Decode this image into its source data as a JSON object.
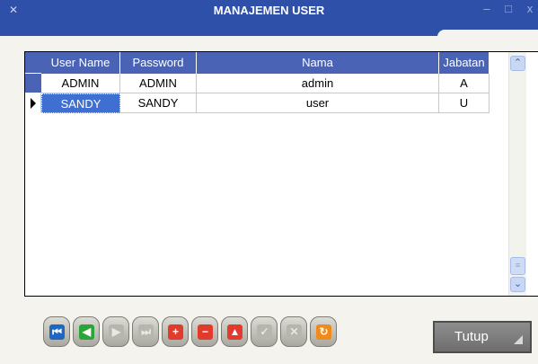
{
  "window": {
    "title": "MANAJEMEN USER",
    "icon": "restore-icon",
    "controls": {
      "minimize": "–",
      "maximize": "□",
      "close": "x"
    }
  },
  "grid": {
    "columns": [
      "User Name",
      "Password",
      "Nama",
      "Jabatan"
    ],
    "rows": [
      {
        "username": "ADMIN",
        "password": "ADMIN",
        "nama": "admin",
        "jabatan": "A"
      },
      {
        "username": "SANDY",
        "password": "SANDY",
        "nama": "user",
        "jabatan": "U"
      }
    ],
    "current_row": 1,
    "selected_column": "User Name"
  },
  "scrollbar": {
    "up_icon": "chevron-up-icon",
    "down_icon": "chevron-down-icon",
    "up_glyph": "⌃",
    "down_glyph": "⌄",
    "thumb_glyph": "≡"
  },
  "navigator": [
    {
      "name": "first-record-button",
      "icon": "first-record-icon",
      "glyph": "⏮",
      "color": "blue",
      "enabled": true
    },
    {
      "name": "previous-record-button",
      "icon": "previous-record-icon",
      "glyph": "◀",
      "color": "green",
      "enabled": true
    },
    {
      "name": "next-record-button",
      "icon": "next-record-icon",
      "glyph": "▶",
      "color": "gray",
      "enabled": false
    },
    {
      "name": "last-record-button",
      "icon": "last-record-icon",
      "glyph": "⏭",
      "color": "gray",
      "enabled": false
    },
    {
      "name": "insert-record-button",
      "icon": "plus-icon",
      "glyph": "+",
      "color": "red",
      "enabled": true
    },
    {
      "name": "delete-record-button",
      "icon": "minus-icon",
      "glyph": "−",
      "color": "red",
      "enabled": true
    },
    {
      "name": "edit-record-button",
      "icon": "triangle-up-icon",
      "glyph": "▲",
      "color": "red",
      "enabled": true
    },
    {
      "name": "post-record-button",
      "icon": "check-icon",
      "glyph": "✓",
      "color": "gray",
      "enabled": false
    },
    {
      "name": "cancel-record-button",
      "icon": "cross-icon",
      "glyph": "✕",
      "color": "gray",
      "enabled": false
    },
    {
      "name": "refresh-button",
      "icon": "refresh-icon",
      "glyph": "↻",
      "color": "orange",
      "enabled": true
    }
  ],
  "close_button": {
    "label": "Tutup"
  },
  "colors": {
    "titlebar": "#2f50a9",
    "header": "#4a63b5",
    "selection": "#3f6fd0",
    "close_button": "#7d7d7d"
  }
}
